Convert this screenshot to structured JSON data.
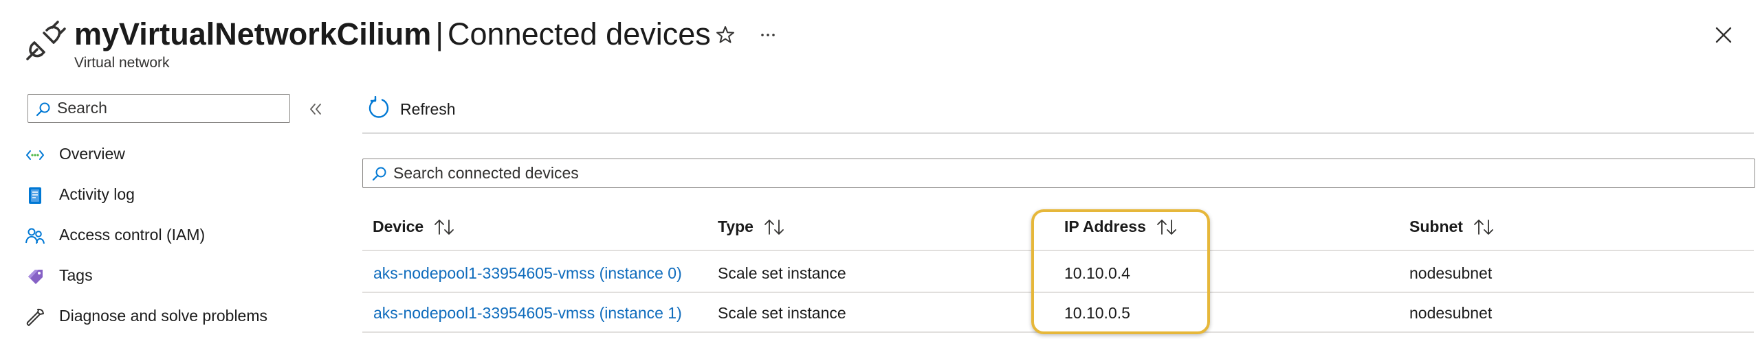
{
  "header": {
    "resource_name": "myVirtualNetworkCilium",
    "separator": "|",
    "page_title": "Connected devices",
    "subtitle": "Virtual network",
    "icons": {
      "resource": "plug-icon",
      "favorite": "star-icon",
      "more": "more-icon",
      "close": "close-icon"
    }
  },
  "sidebar": {
    "search_placeholder": "Search",
    "items": [
      {
        "label": "Overview",
        "icon": "overview-icon"
      },
      {
        "label": "Activity log",
        "icon": "activity-log-icon"
      },
      {
        "label": "Access control (IAM)",
        "icon": "people-icon"
      },
      {
        "label": "Tags",
        "icon": "tag-icon"
      },
      {
        "label": "Diagnose and solve problems",
        "icon": "wrench-icon"
      }
    ]
  },
  "toolbar": {
    "refresh_label": "Refresh"
  },
  "main": {
    "search_placeholder": "Search connected devices",
    "columns": [
      "Device",
      "Type",
      "IP Address",
      "Subnet"
    ],
    "rows": [
      {
        "device": "aks-nodepool1-33954605-vmss (instance 0)",
        "type": "Scale set instance",
        "ip": "10.10.0.4",
        "subnet": "nodesubnet"
      },
      {
        "device": "aks-nodepool1-33954605-vmss (instance 1)",
        "type": "Scale set instance",
        "ip": "10.10.0.5",
        "subnet": "nodesubnet"
      }
    ]
  },
  "colors": {
    "link": "#0f6cbd",
    "accent": "#0078d4",
    "highlight": "#e6b73a"
  }
}
